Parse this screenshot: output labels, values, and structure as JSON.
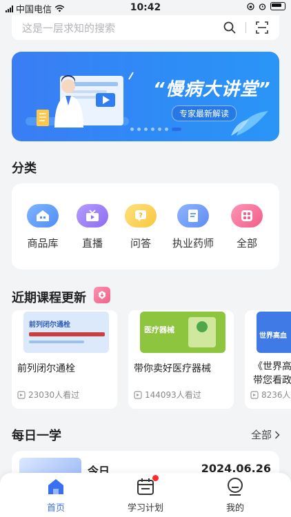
{
  "status_bar": {
    "carrier": "中国电信",
    "time": "10:42"
  },
  "search": {
    "placeholder": "这是一层求知的搜索"
  },
  "banner": {
    "title": "“慢病大讲堂”",
    "subtitle": "专家最新解读"
  },
  "categories": {
    "title": "分类",
    "items": [
      {
        "label": "商品库",
        "icon": "store-icon",
        "color": "#4e8ef6"
      },
      {
        "label": "直播",
        "icon": "live-tv-icon",
        "color": "#8d6cf2"
      },
      {
        "label": "问答",
        "icon": "question-icon",
        "color": "#f7c842"
      },
      {
        "label": "执业药师",
        "icon": "document-icon",
        "color": "#5f8df2"
      },
      {
        "label": "全部",
        "icon": "grid-icon",
        "color": "#f05e8a"
      }
    ]
  },
  "recent_courses": {
    "title": "近期课程更新",
    "items": [
      {
        "name": "前列闭尔通栓",
        "views": "23030人看过",
        "thumb_text": "前列闭尔通栓",
        "thumb_color": "#dbe9fb"
      },
      {
        "name": "带你卖好医疗器械",
        "views": "144093人看过",
        "thumb_text": "医疗器械",
        "thumb_color": "#8dc53e"
      },
      {
        "name": "《世界高血压日》带您看政策",
        "views": "8236人",
        "thumb_text": "世界高血",
        "thumb_color": "#3f7ae6"
      }
    ]
  },
  "daily": {
    "title": "每日一学",
    "more": "全部",
    "label": "今日",
    "date": "2024.06.26"
  },
  "tabbar": {
    "items": [
      {
        "label": "首页",
        "active": true
      },
      {
        "label": "学习计划",
        "active": false
      },
      {
        "label": "我的",
        "active": false
      }
    ]
  }
}
